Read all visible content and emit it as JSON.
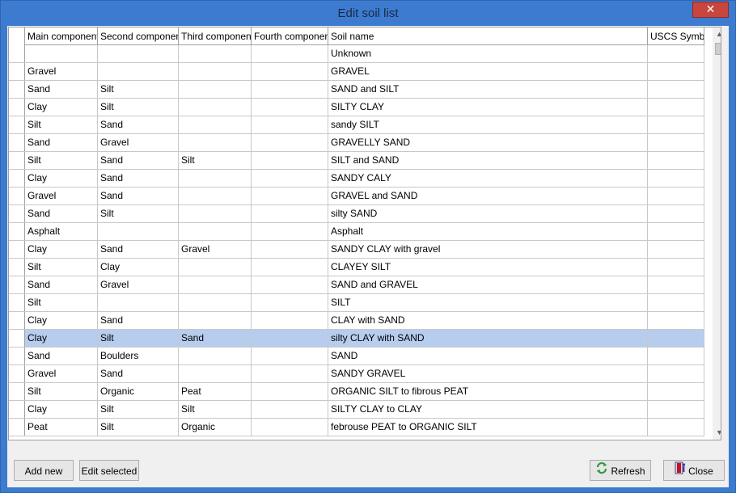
{
  "window": {
    "title": "Edit soil list",
    "close_glyph": "✕"
  },
  "columns": [
    "Main component",
    "Second component",
    "Third component",
    "Fourth component",
    "Soil name",
    "USCS Symbol"
  ],
  "rows": [
    [
      "",
      "",
      "",
      "",
      "Unknown",
      ""
    ],
    [
      "Gravel",
      "",
      "",
      "",
      "GRAVEL",
      ""
    ],
    [
      "Sand",
      "Silt",
      "",
      "",
      "SAND and SILT",
      ""
    ],
    [
      "Clay",
      "Silt",
      "",
      "",
      "SILTY CLAY",
      ""
    ],
    [
      "Silt",
      "Sand",
      "",
      "",
      "sandy SILT",
      ""
    ],
    [
      "Sand",
      "Gravel",
      "",
      "",
      "GRAVELLY SAND",
      ""
    ],
    [
      "Silt",
      "Sand",
      "Silt",
      "",
      "SILT and SAND",
      ""
    ],
    [
      "Clay",
      "Sand",
      "",
      "",
      "SANDY CALY",
      ""
    ],
    [
      "Gravel",
      "Sand",
      "",
      "",
      "GRAVEL and SAND",
      ""
    ],
    [
      "Sand",
      "Silt",
      "",
      "",
      "silty SAND",
      ""
    ],
    [
      "Asphalt",
      "",
      "",
      "",
      "Asphalt",
      ""
    ],
    [
      "Clay",
      "Sand",
      "Gravel",
      "",
      "SANDY CLAY with gravel",
      ""
    ],
    [
      "Silt",
      "Clay",
      "",
      "",
      "CLAYEY SILT",
      ""
    ],
    [
      "Sand",
      "Gravel",
      "",
      "",
      "SAND and GRAVEL",
      ""
    ],
    [
      "Silt",
      "",
      "",
      "",
      "SILT",
      ""
    ],
    [
      "Clay",
      "Sand",
      "",
      "",
      "CLAY with SAND",
      ""
    ],
    [
      "Clay",
      "Silt",
      "Sand",
      "",
      "silty CLAY with SAND",
      ""
    ],
    [
      "Sand",
      "Boulders",
      "",
      "",
      "SAND",
      ""
    ],
    [
      "Gravel",
      "Sand",
      "",
      "",
      "SANDY GRAVEL",
      ""
    ],
    [
      "Silt",
      "Organic",
      "Peat",
      "",
      "ORGANIC SILT to fibrous PEAT",
      ""
    ],
    [
      "Clay",
      "Silt",
      "Silt",
      "",
      "SILTY CLAY to CLAY",
      ""
    ],
    [
      "Peat",
      "Silt",
      "Organic",
      "",
      "febrouse PEAT to ORGANIC SILT",
      ""
    ]
  ],
  "selected_row_index": 16,
  "selected_color": "#b7cdee",
  "buttons": {
    "add_new": "Add new",
    "edit_selected": "Edit selected",
    "refresh": "Refresh",
    "refresh_icon": "refresh-icon",
    "close": "Close",
    "close_icon": "exit-door-icon"
  },
  "scrollbar": {
    "up": "▲",
    "down": "▼"
  },
  "colors": {
    "title_bar": "#3c7bd0",
    "close_button": "#c7463d",
    "refresh_icon": "#2e9a3a",
    "grid_border": "#a0a0a0"
  }
}
